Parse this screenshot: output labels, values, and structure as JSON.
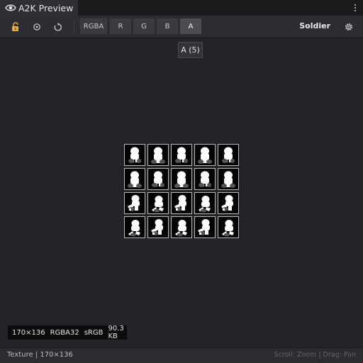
{
  "tab": {
    "title": "A2K Preview",
    "icon": "eye-icon"
  },
  "toolbar": {
    "icons": [
      "lock-open-icon",
      "target-icon",
      "refresh-icon"
    ],
    "channels": [
      "RGBA",
      "R",
      "G",
      "B",
      "A"
    ],
    "active_channel": "A",
    "asset_name": "Soldier",
    "settings_icon": "gear-icon"
  },
  "tooltip": {
    "text": "A (5)"
  },
  "preview": {
    "rows": 4,
    "cols": 5,
    "frames": 20
  },
  "info": {
    "dimensions": "170×136",
    "format": "RGBA32",
    "colorspace": "sRGB",
    "size": "90.3 KB"
  },
  "status": {
    "left": "Texture | 170×136",
    "right": "Scroll: Zoom | Drag: Pan"
  },
  "colors": {
    "background": "#232428",
    "toolbar": "#2c2d31",
    "active_channel": "#4c4d53"
  }
}
